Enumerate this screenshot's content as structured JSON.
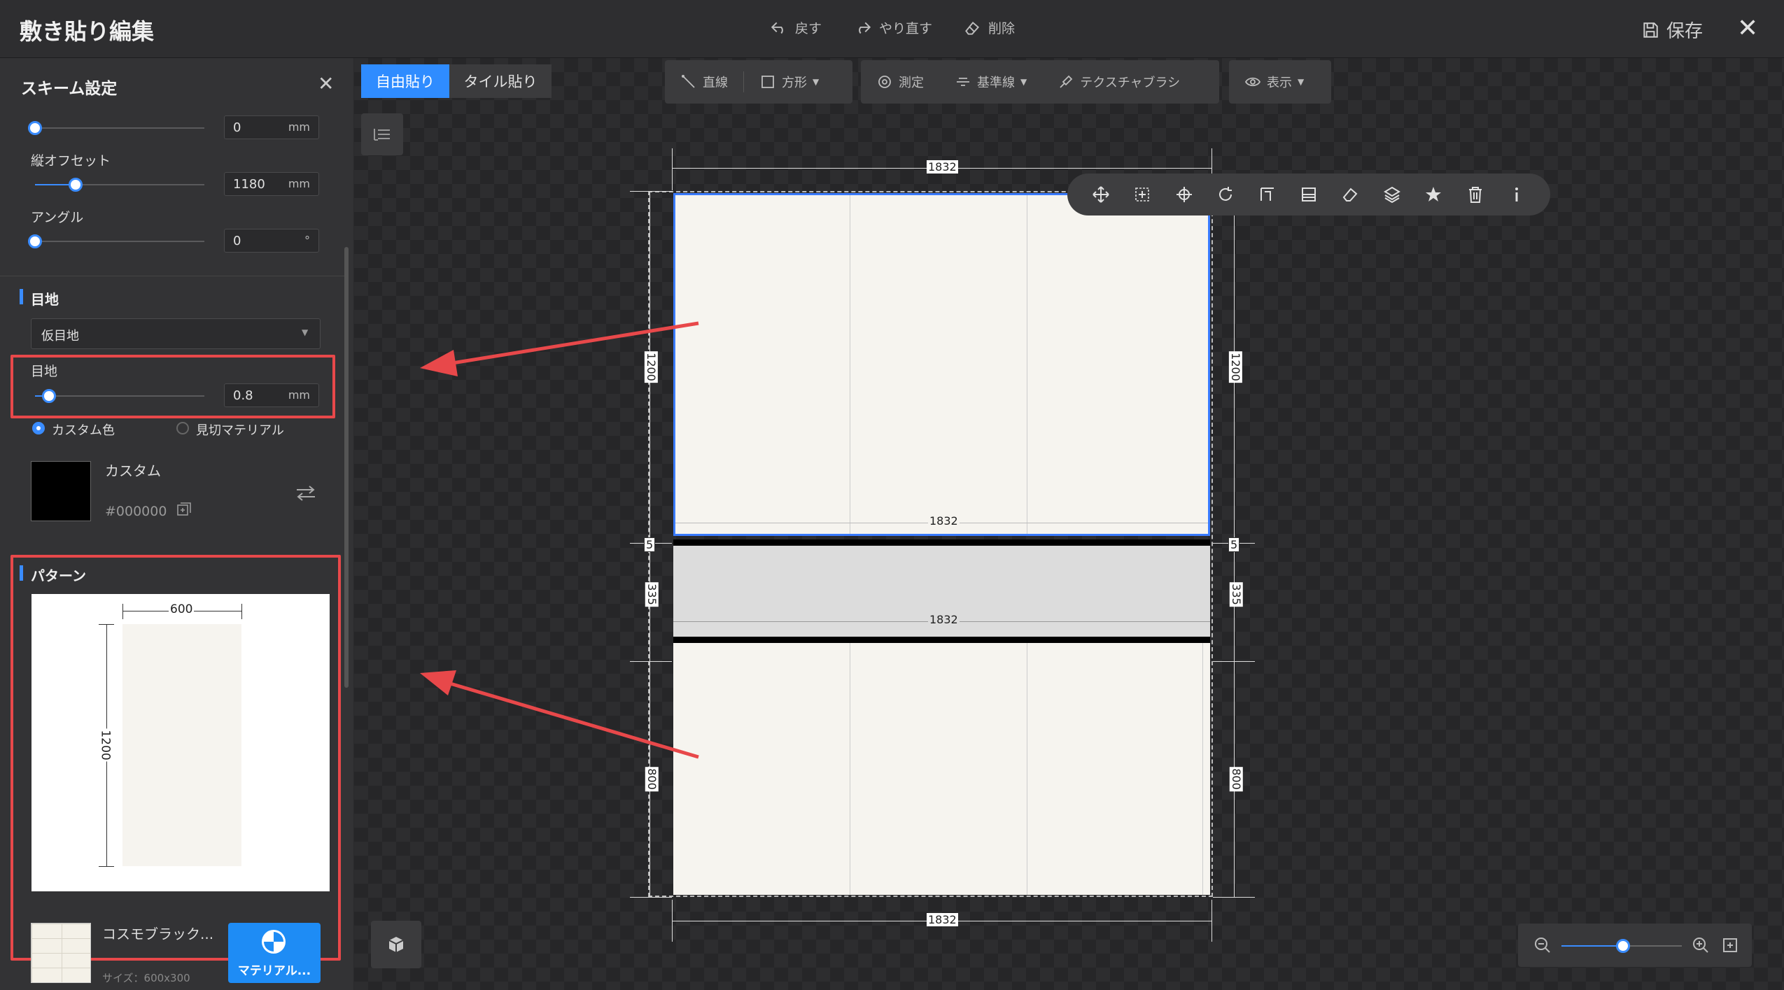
{
  "header": {
    "title": "敷き貼り編集",
    "undo": "戻す",
    "redo": "やり直す",
    "delete": "削除",
    "save": "保存"
  },
  "left_panel": {
    "title": "スキーム設定",
    "offset_top": {
      "value": "0",
      "unit": "mm",
      "level": 0.0
    },
    "vertical_offset": {
      "label": "縦オフセット",
      "value": "1180",
      "unit": "mm",
      "level": 0.23
    },
    "angle": {
      "label": "アングル",
      "value": "0",
      "unit": "°",
      "level": 0.0
    },
    "joint_section": {
      "title": "目地",
      "type_select": "仮目地",
      "joint_label": "目地",
      "joint_value": "0.8",
      "joint_unit": "mm",
      "joint_level": 0.08,
      "radio_custom": "カスタム色",
      "radio_material": "見切マテリアル",
      "color_name": "カスタム",
      "color_hex": "#000000"
    },
    "pattern_section": {
      "title": "パターン",
      "width_label": "600",
      "height_label": "1200"
    },
    "material": {
      "name": "コスモブラック...",
      "size": "サイズ：600x300",
      "button": "マテリアル..."
    }
  },
  "canvas": {
    "mode_tabs": [
      "自由貼り",
      "タイル貼り"
    ],
    "active_mode": "自由貼り",
    "tools": {
      "line": "直線",
      "rect": "方形",
      "measure": "測定",
      "baseline": "基準線",
      "texture_brush": "テクスチャブラシ",
      "display": "表示"
    },
    "dimensions": {
      "top": "1832",
      "bottom": "1832",
      "upper_inner": "1832",
      "middle_inner": "1832",
      "upper_left": "1200",
      "upper_right": "1200",
      "gap_left": "5",
      "gap_right": "5",
      "middle_left": "335",
      "middle_right": "335",
      "lower_left": "800",
      "lower_right": "800"
    },
    "zoom_level": 0.5
  },
  "colors": {
    "accent": "#3a8cff",
    "highlight_red": "#e8484a",
    "tile": "#f6f4ef",
    "strip": "#dcdcdc",
    "joint": "#000000"
  }
}
